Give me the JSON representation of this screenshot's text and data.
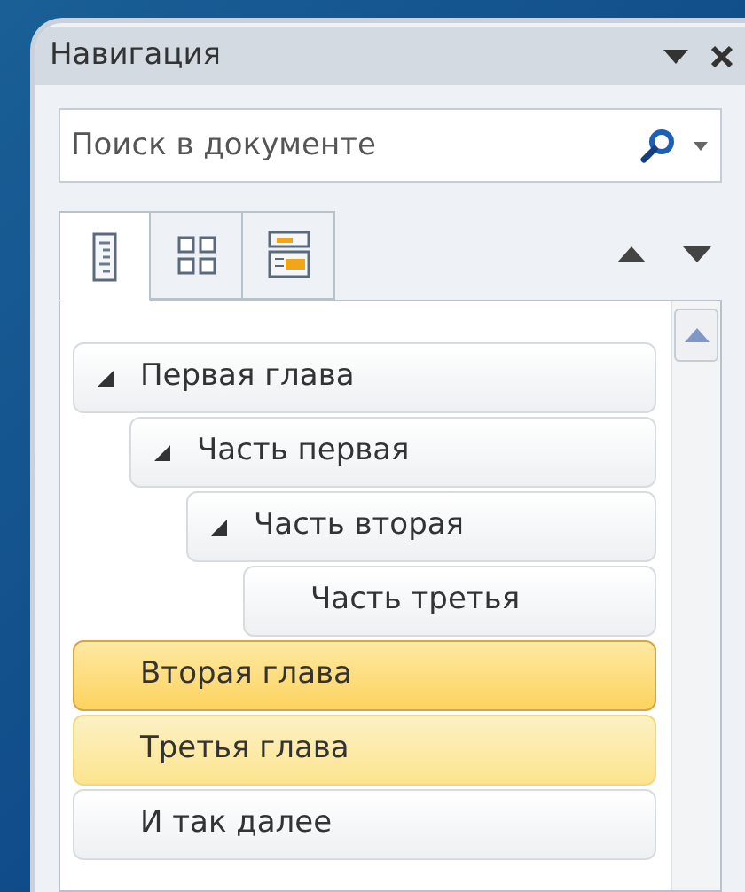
{
  "pane": {
    "title": "Навигация"
  },
  "search": {
    "placeholder": "Поиск в документе"
  },
  "tabs": [
    {
      "kind": "headings",
      "selected": true
    },
    {
      "kind": "pages",
      "selected": false
    },
    {
      "kind": "results",
      "selected": false
    }
  ],
  "headings": [
    {
      "label": "Первая глава",
      "selected": false,
      "hovered": false,
      "expanded": true,
      "children": [
        {
          "label": "Часть первая",
          "selected": false,
          "hovered": false,
          "expanded": true,
          "children": [
            {
              "label": "Часть вторая",
              "selected": false,
              "hovered": false,
              "expanded": true,
              "children": [
                {
                  "label": "Часть третья",
                  "selected": false,
                  "hovered": false
                }
              ]
            }
          ]
        }
      ]
    },
    {
      "label": "Вторая глава",
      "selected": true,
      "hovered": false
    },
    {
      "label": "Третья глава",
      "selected": false,
      "hovered": true
    },
    {
      "label": "И так далее",
      "selected": false,
      "hovered": false
    }
  ]
}
